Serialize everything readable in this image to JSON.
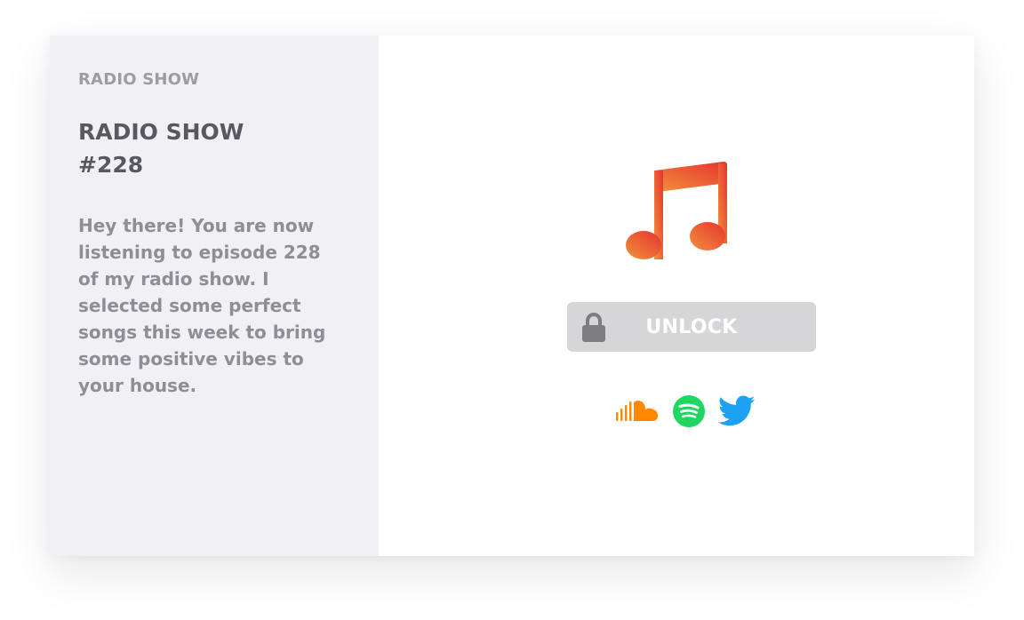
{
  "sidebar": {
    "eyebrow": "RADIO SHOW",
    "title_line1": "RADIO SHOW",
    "title_line2": "#228",
    "description": "Hey there! You are now listening to episode 228 of my radio show. I selected some perfect songs this week to bring some positive vibes to your house."
  },
  "main": {
    "icon": "music-note-icon",
    "unlock": {
      "label": "UNLOCK",
      "icon": "lock-icon"
    },
    "social": [
      {
        "name": "soundcloud",
        "icon": "soundcloud-icon",
        "color": "#ff8800"
      },
      {
        "name": "spotify",
        "icon": "spotify-icon",
        "color": "#1ed760"
      },
      {
        "name": "twitter",
        "icon": "twitter-icon",
        "color": "#1da1f2"
      }
    ]
  },
  "colors": {
    "sidebar_bg": "#f0f0f5",
    "button_bg": "#d6d6d8",
    "note_gradient_start": "#f0923b",
    "note_gradient_end": "#e6332f"
  }
}
